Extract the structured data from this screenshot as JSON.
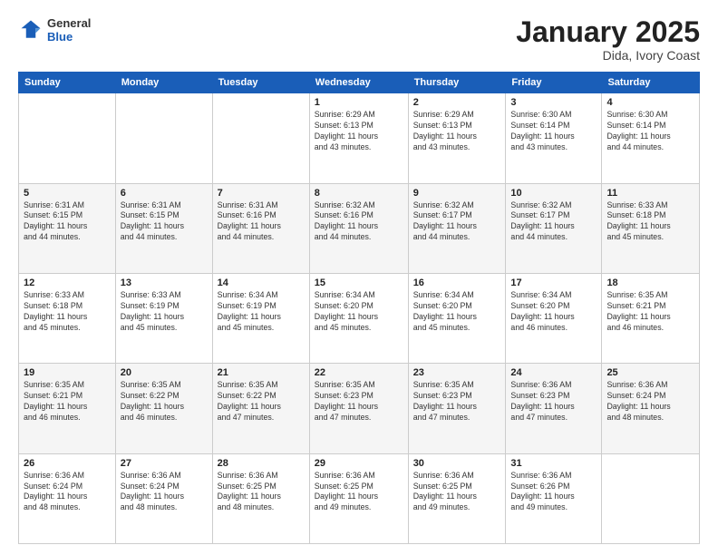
{
  "header": {
    "logo": {
      "general": "General",
      "blue": "Blue"
    },
    "title": "January 2025",
    "subtitle": "Dida, Ivory Coast"
  },
  "weekdays": [
    "Sunday",
    "Monday",
    "Tuesday",
    "Wednesday",
    "Thursday",
    "Friday",
    "Saturday"
  ],
  "weeks": [
    [
      {
        "day": "",
        "info": ""
      },
      {
        "day": "",
        "info": ""
      },
      {
        "day": "",
        "info": ""
      },
      {
        "day": "1",
        "info": "Sunrise: 6:29 AM\nSunset: 6:13 PM\nDaylight: 11 hours\nand 43 minutes."
      },
      {
        "day": "2",
        "info": "Sunrise: 6:29 AM\nSunset: 6:13 PM\nDaylight: 11 hours\nand 43 minutes."
      },
      {
        "day": "3",
        "info": "Sunrise: 6:30 AM\nSunset: 6:14 PM\nDaylight: 11 hours\nand 43 minutes."
      },
      {
        "day": "4",
        "info": "Sunrise: 6:30 AM\nSunset: 6:14 PM\nDaylight: 11 hours\nand 44 minutes."
      }
    ],
    [
      {
        "day": "5",
        "info": "Sunrise: 6:31 AM\nSunset: 6:15 PM\nDaylight: 11 hours\nand 44 minutes."
      },
      {
        "day": "6",
        "info": "Sunrise: 6:31 AM\nSunset: 6:15 PM\nDaylight: 11 hours\nand 44 minutes."
      },
      {
        "day": "7",
        "info": "Sunrise: 6:31 AM\nSunset: 6:16 PM\nDaylight: 11 hours\nand 44 minutes."
      },
      {
        "day": "8",
        "info": "Sunrise: 6:32 AM\nSunset: 6:16 PM\nDaylight: 11 hours\nand 44 minutes."
      },
      {
        "day": "9",
        "info": "Sunrise: 6:32 AM\nSunset: 6:17 PM\nDaylight: 11 hours\nand 44 minutes."
      },
      {
        "day": "10",
        "info": "Sunrise: 6:32 AM\nSunset: 6:17 PM\nDaylight: 11 hours\nand 44 minutes."
      },
      {
        "day": "11",
        "info": "Sunrise: 6:33 AM\nSunset: 6:18 PM\nDaylight: 11 hours\nand 45 minutes."
      }
    ],
    [
      {
        "day": "12",
        "info": "Sunrise: 6:33 AM\nSunset: 6:18 PM\nDaylight: 11 hours\nand 45 minutes."
      },
      {
        "day": "13",
        "info": "Sunrise: 6:33 AM\nSunset: 6:19 PM\nDaylight: 11 hours\nand 45 minutes."
      },
      {
        "day": "14",
        "info": "Sunrise: 6:34 AM\nSunset: 6:19 PM\nDaylight: 11 hours\nand 45 minutes."
      },
      {
        "day": "15",
        "info": "Sunrise: 6:34 AM\nSunset: 6:20 PM\nDaylight: 11 hours\nand 45 minutes."
      },
      {
        "day": "16",
        "info": "Sunrise: 6:34 AM\nSunset: 6:20 PM\nDaylight: 11 hours\nand 45 minutes."
      },
      {
        "day": "17",
        "info": "Sunrise: 6:34 AM\nSunset: 6:20 PM\nDaylight: 11 hours\nand 46 minutes."
      },
      {
        "day": "18",
        "info": "Sunrise: 6:35 AM\nSunset: 6:21 PM\nDaylight: 11 hours\nand 46 minutes."
      }
    ],
    [
      {
        "day": "19",
        "info": "Sunrise: 6:35 AM\nSunset: 6:21 PM\nDaylight: 11 hours\nand 46 minutes."
      },
      {
        "day": "20",
        "info": "Sunrise: 6:35 AM\nSunset: 6:22 PM\nDaylight: 11 hours\nand 46 minutes."
      },
      {
        "day": "21",
        "info": "Sunrise: 6:35 AM\nSunset: 6:22 PM\nDaylight: 11 hours\nand 47 minutes."
      },
      {
        "day": "22",
        "info": "Sunrise: 6:35 AM\nSunset: 6:23 PM\nDaylight: 11 hours\nand 47 minutes."
      },
      {
        "day": "23",
        "info": "Sunrise: 6:35 AM\nSunset: 6:23 PM\nDaylight: 11 hours\nand 47 minutes."
      },
      {
        "day": "24",
        "info": "Sunrise: 6:36 AM\nSunset: 6:23 PM\nDaylight: 11 hours\nand 47 minutes."
      },
      {
        "day": "25",
        "info": "Sunrise: 6:36 AM\nSunset: 6:24 PM\nDaylight: 11 hours\nand 48 minutes."
      }
    ],
    [
      {
        "day": "26",
        "info": "Sunrise: 6:36 AM\nSunset: 6:24 PM\nDaylight: 11 hours\nand 48 minutes."
      },
      {
        "day": "27",
        "info": "Sunrise: 6:36 AM\nSunset: 6:24 PM\nDaylight: 11 hours\nand 48 minutes."
      },
      {
        "day": "28",
        "info": "Sunrise: 6:36 AM\nSunset: 6:25 PM\nDaylight: 11 hours\nand 48 minutes."
      },
      {
        "day": "29",
        "info": "Sunrise: 6:36 AM\nSunset: 6:25 PM\nDaylight: 11 hours\nand 49 minutes."
      },
      {
        "day": "30",
        "info": "Sunrise: 6:36 AM\nSunset: 6:25 PM\nDaylight: 11 hours\nand 49 minutes."
      },
      {
        "day": "31",
        "info": "Sunrise: 6:36 AM\nSunset: 6:26 PM\nDaylight: 11 hours\nand 49 minutes."
      },
      {
        "day": "",
        "info": ""
      }
    ]
  ]
}
